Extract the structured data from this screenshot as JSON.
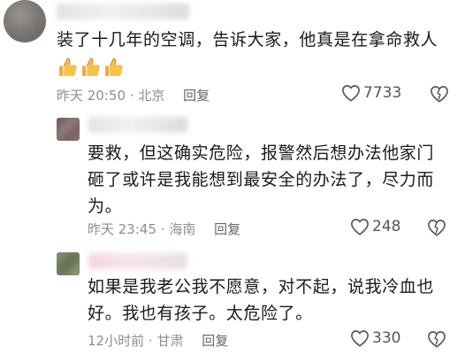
{
  "comments": [
    {
      "text": "装了十几年的空调，告诉大家，他真是在拿命救人",
      "emoji": [
        "thumbs-up",
        "thumbs-up",
        "thumbs-up"
      ],
      "time": "昨天 20:50",
      "location": "北京",
      "reply_label": "回复",
      "likes": "7733"
    },
    {
      "text": "要救，但这确实危险，报警然后想办法他家门砸了或许是我能想到最安全的办法了，尽力而为。",
      "time": "昨天 23:45",
      "location": "海南",
      "reply_label": "回复",
      "likes": "248"
    },
    {
      "text": "如果是我老公我不愿意，对不起，说我冷血也好。我也有孩子。太危险了。",
      "time": "12小时前",
      "location": "甘肃",
      "reply_label": "回复",
      "likes": "330"
    }
  ],
  "colors": {
    "text": "#1a1a1a",
    "meta": "#8f8f8f",
    "icon": "#555555"
  }
}
